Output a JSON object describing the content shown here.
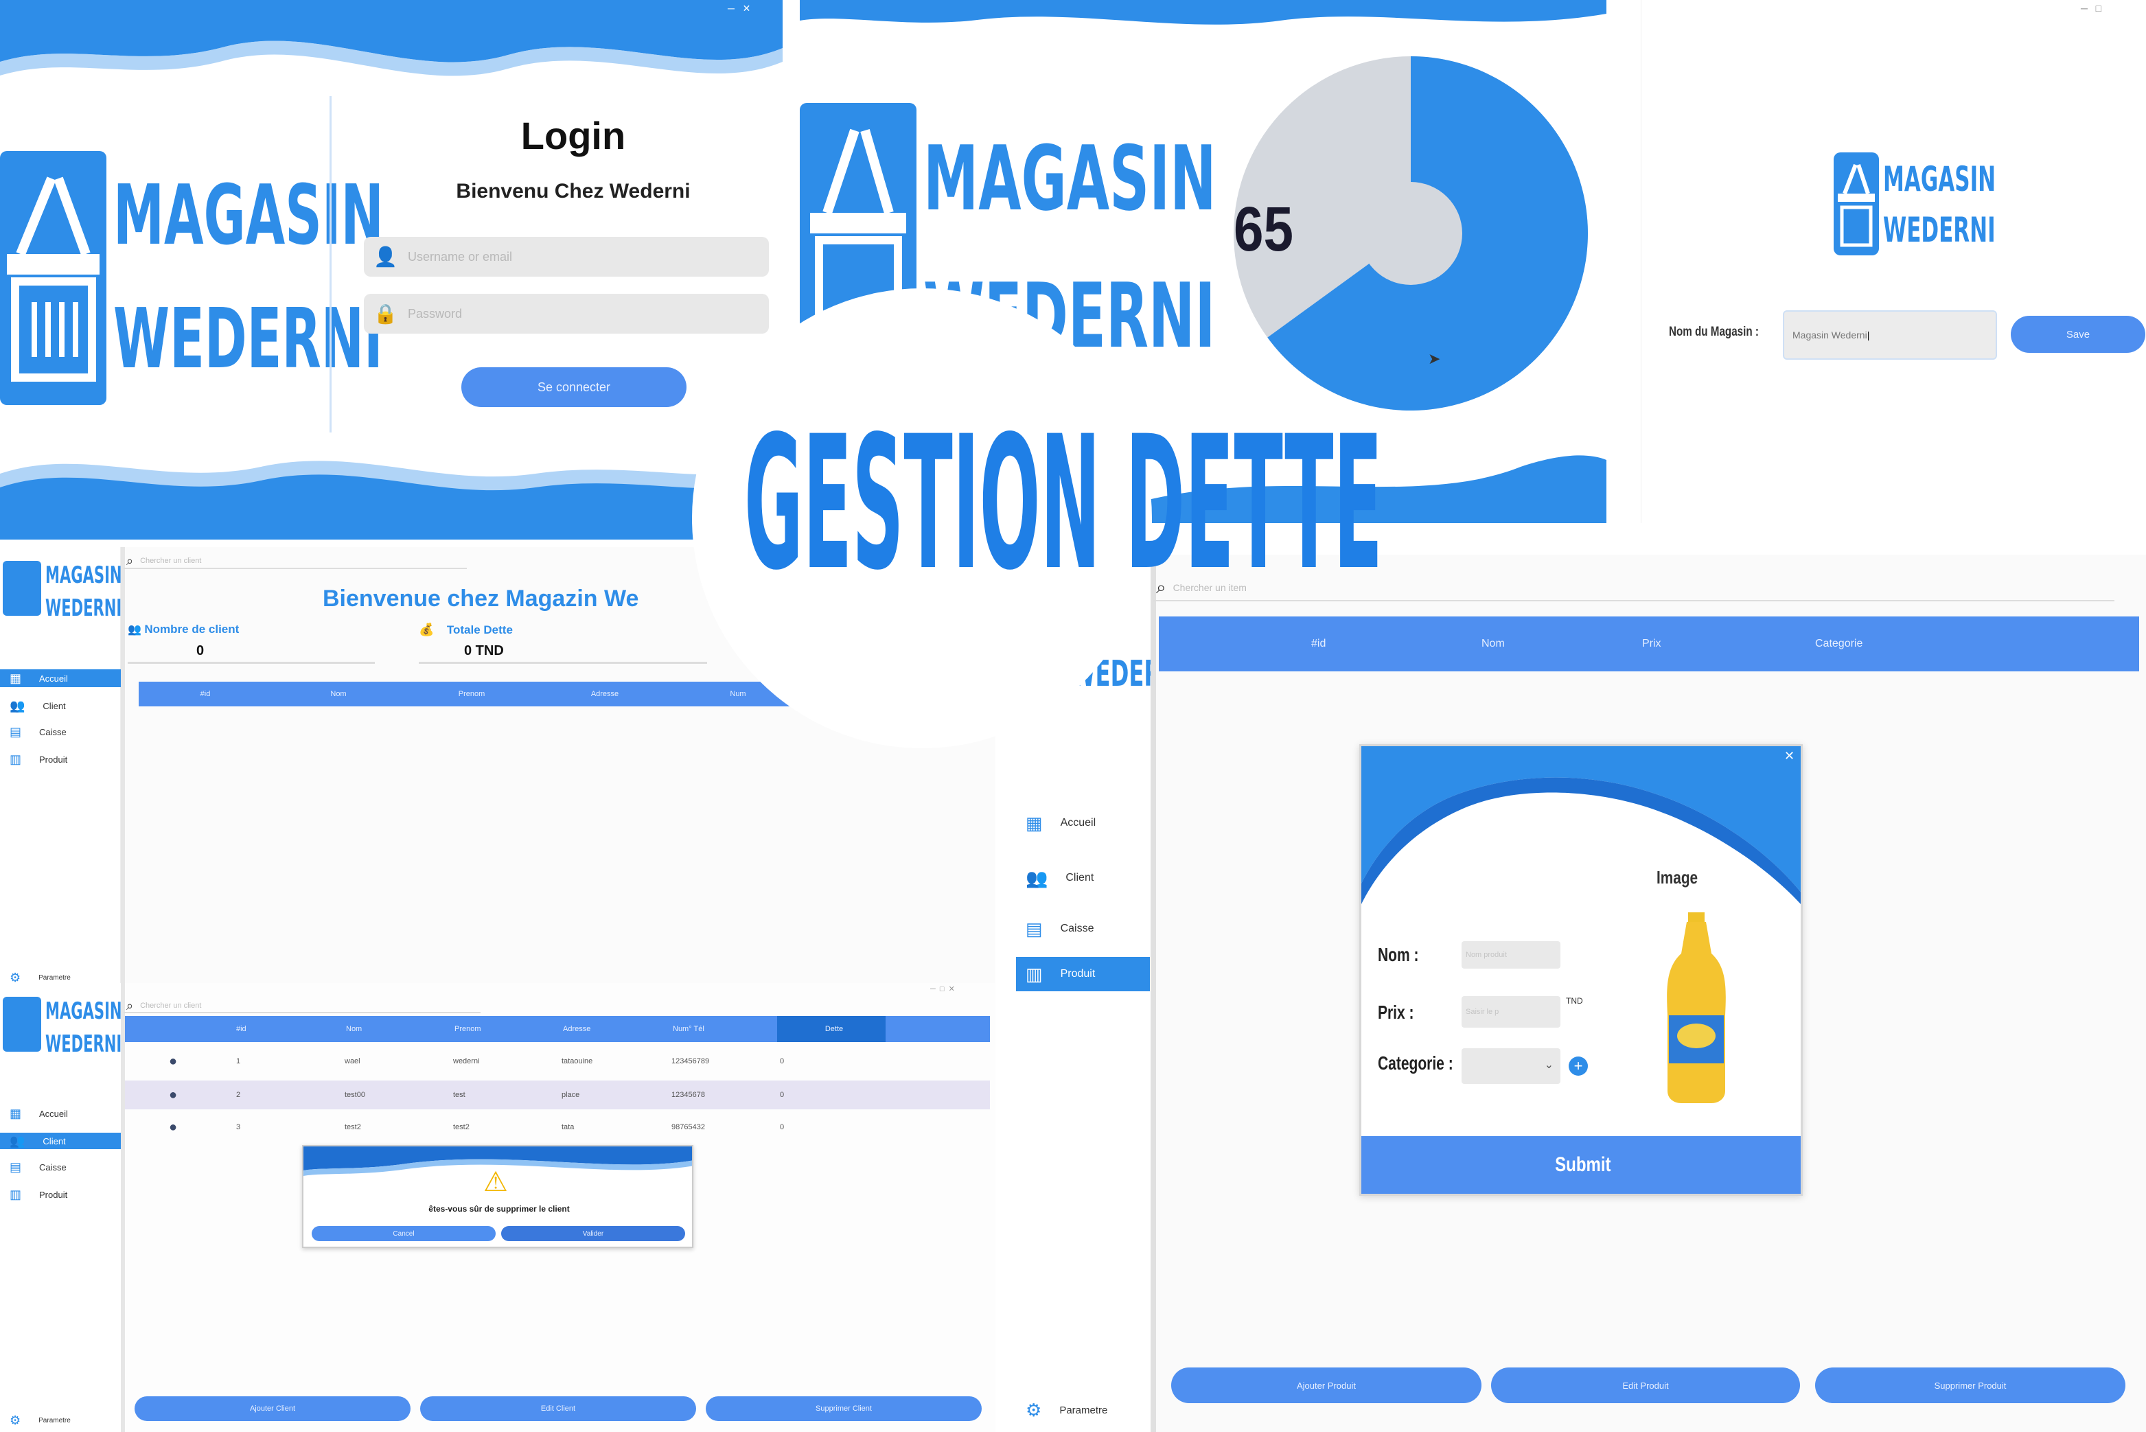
{
  "login": {
    "brand_line1": "MAGASIN",
    "brand_line2": "WEDERNI",
    "title": "Login",
    "subtitle": "Bienvenu Chez Wederni",
    "username_placeholder": "Username or email",
    "password_placeholder": "Password",
    "submit_label": "Se connecter"
  },
  "splash": {
    "brand_line1": "MAGASIN",
    "brand_line2": "WEDERNI",
    "progress_value": "65",
    "progress_fraction": 0.65
  },
  "setup": {
    "brand_line1": "MAGASIN",
    "brand_line2": "WEDERNI",
    "field_label": "Nom du Magasin :",
    "field_value": "Magasin Wederni",
    "save_label": "Save"
  },
  "center_title": "GESTION DETTE",
  "dashboard": {
    "brand_line1": "MAGASIN",
    "brand_line2": "WEDERNI",
    "search_placeholder": "Chercher un client",
    "welcome": "Bienvenue chez Magazin We",
    "stats": [
      {
        "label": "Nombre de client",
        "value": "0"
      },
      {
        "label": "Totale Dette",
        "value": "0 TND"
      }
    ],
    "columns": [
      "#id",
      "Nom",
      "Prenom",
      "Adresse",
      "Num"
    ],
    "menu": [
      "Accueil",
      "Client",
      "Caisse",
      "Produit"
    ],
    "settings_label": "Parametre"
  },
  "clients": {
    "brand_line1": "MAGASIN",
    "brand_line2": "WEDERNI",
    "search_placeholder": "Chercher un client",
    "columns": [
      "#id",
      "Nom",
      "Prenom",
      "Adresse",
      "Num° Tél",
      "Dette"
    ],
    "rows": [
      {
        "id": "1",
        "nom": "wael",
        "prenom": "wederni",
        "adresse": "tataouine",
        "tel": "123456789",
        "dette": "0"
      },
      {
        "id": "2",
        "nom": "test00",
        "prenom": "test",
        "adresse": "place",
        "tel": "12345678",
        "dette": "0"
      },
      {
        "id": "3",
        "nom": "test2",
        "prenom": "test2",
        "adresse": "tata",
        "tel": "98765432",
        "dette": "0"
      }
    ],
    "menu": [
      "Accueil",
      "Client",
      "Caisse",
      "Produit"
    ],
    "settings_label": "Parametre",
    "dialog": {
      "message": "êtes-vous sûr de supprimer le client",
      "cancel_label": "Cancel",
      "confirm_label": "Valider"
    },
    "buttons": [
      "Ajouter Client",
      "Edit Client",
      "Supprimer Client"
    ]
  },
  "products": {
    "brand_line2": "WEDERNI",
    "search_placeholder": "Chercher un item",
    "columns": [
      "#id",
      "Nom",
      "Prix",
      "Categorie"
    ],
    "menu": [
      "Accueil",
      "Client",
      "Caisse",
      "Produit"
    ],
    "settings_label": "Parametre",
    "buttons": [
      "Ajouter Produit",
      "Edit Produit",
      "Supprimer Produit"
    ],
    "form": {
      "image_label": "Image",
      "nom_label": "Nom :",
      "nom_placeholder": "Nom produit",
      "prix_label": "Prix :",
      "prix_placeholder": "Saisir le p",
      "prix_unit": "TND",
      "categorie_label": "Categorie :",
      "submit_label": "Submit"
    }
  },
  "colors": {
    "accent": "#2e8de8",
    "button": "#4f8ff0",
    "wave_dark": "#1f6fd1"
  }
}
